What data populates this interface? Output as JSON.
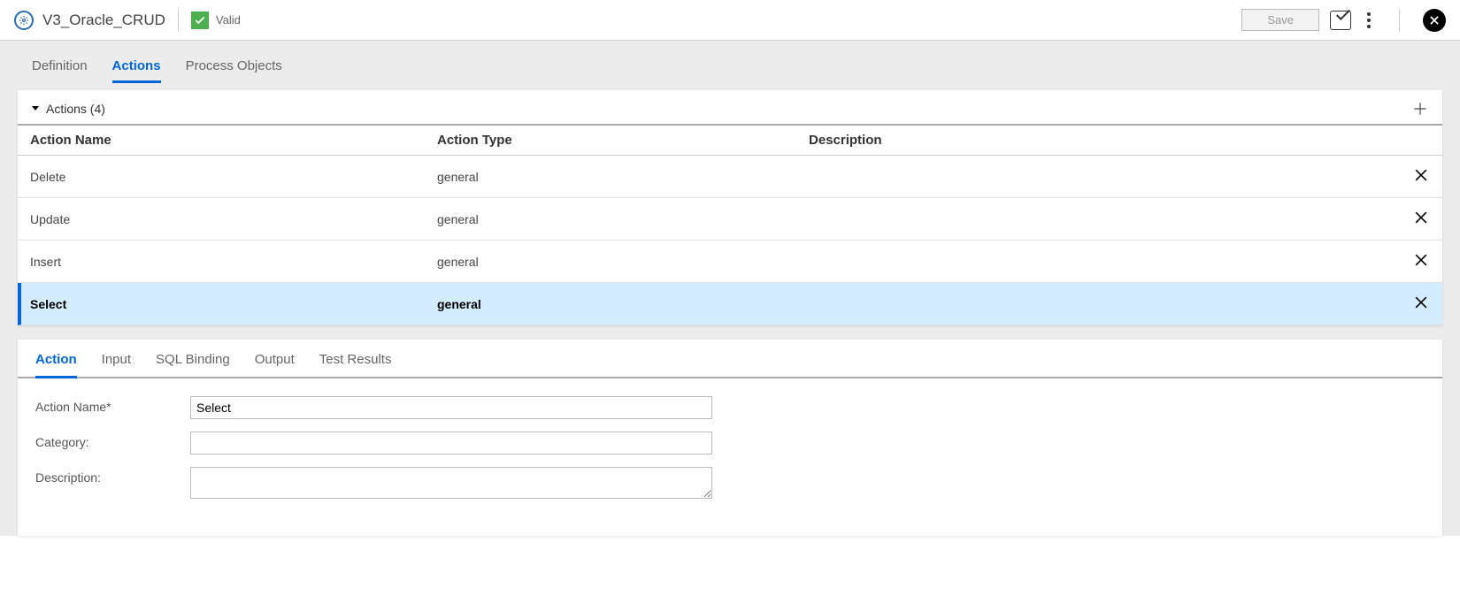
{
  "header": {
    "title": "V3_Oracle_CRUD",
    "validLabel": "Valid",
    "saveLabel": "Save"
  },
  "topTabs": {
    "definition": "Definition",
    "actions": "Actions",
    "processObjects": "Process Objects"
  },
  "actionsSection": {
    "title": "Actions (4)",
    "columns": {
      "name": "Action Name",
      "type": "Action Type",
      "desc": "Description"
    },
    "rows": [
      {
        "name": "Delete",
        "type": "general",
        "desc": ""
      },
      {
        "name": "Update",
        "type": "general",
        "desc": ""
      },
      {
        "name": "Insert",
        "type": "general",
        "desc": ""
      },
      {
        "name": "Select",
        "type": "general",
        "desc": ""
      }
    ],
    "selectedIndex": 3
  },
  "subTabs": {
    "action": "Action",
    "input": "Input",
    "sqlBinding": "SQL Binding",
    "output": "Output",
    "testResults": "Test Results"
  },
  "form": {
    "actionNameLabel": "Action Name*",
    "actionNameValue": "Select",
    "categoryLabel": "Category:",
    "categoryValue": "",
    "descriptionLabel": "Description:",
    "descriptionValue": ""
  }
}
